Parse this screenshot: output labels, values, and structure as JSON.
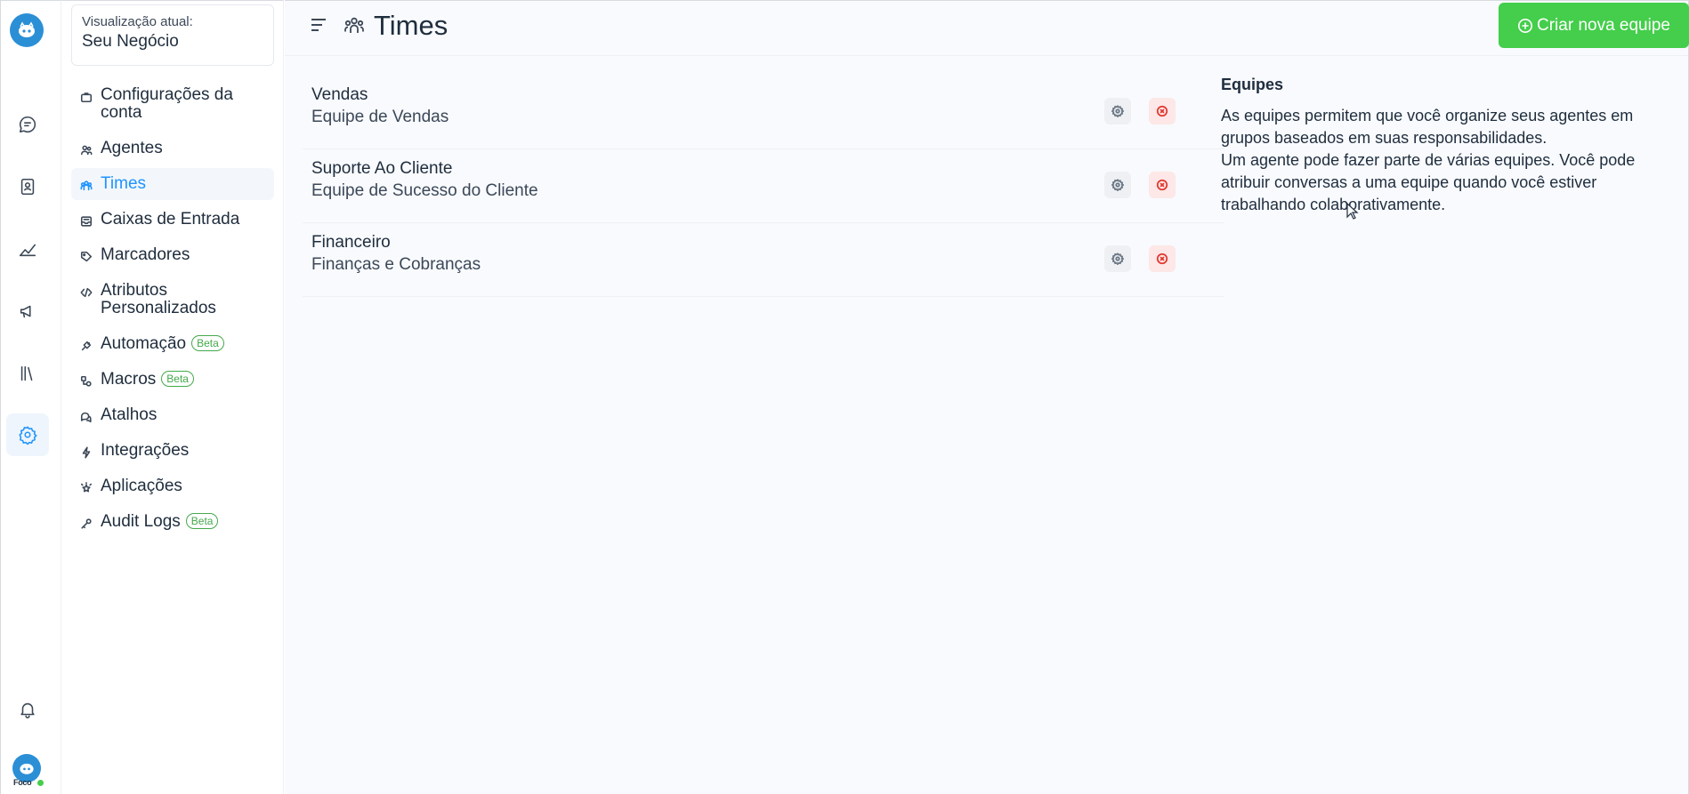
{
  "sidebar": {
    "account_label": "Visualização atual:",
    "account_value": "Seu Negócio",
    "items": [
      {
        "label": "Configurações da conta",
        "icon": "briefcase-icon"
      },
      {
        "label": "Agentes",
        "icon": "people-icon"
      },
      {
        "label": "Times",
        "icon": "people-team-icon"
      },
      {
        "label": "Caixas de Entrada",
        "icon": "mail-inbox-icon"
      },
      {
        "label": "Marcadores",
        "icon": "tag-icon"
      },
      {
        "label": "Atributos Personalizados",
        "icon": "code-icon"
      },
      {
        "label": "Automação",
        "icon": "automation-icon",
        "badge": "Beta"
      },
      {
        "label": "Macros",
        "icon": "flowchart-icon",
        "badge": "Beta"
      },
      {
        "label": "Atalhos",
        "icon": "chat-multiple-icon"
      },
      {
        "label": "Integrações",
        "icon": "flash-icon"
      },
      {
        "label": "Aplicações",
        "icon": "star-emphasis-icon"
      },
      {
        "label": "Audit Logs",
        "icon": "key-icon",
        "badge": "Beta"
      }
    ]
  },
  "rail": {
    "avatar_text": "Foco"
  },
  "header": {
    "title": "Times",
    "create_button": "Criar nova equipe"
  },
  "teams": [
    {
      "name": "Vendas",
      "description": "Equipe de Vendas"
    },
    {
      "name": "Suporte Ao Cliente",
      "description": "Equipe de Sucesso do Cliente"
    },
    {
      "name": "Financeiro",
      "description": "Finanças e Cobranças"
    }
  ],
  "help": {
    "title": "Equipes",
    "paragraph1": "As equipes permitem que você organize seus agentes em grupos baseados em suas responsabilidades.",
    "paragraph2": "Um agente pode fazer parte de várias equipes. Você pode atribuir conversas a uma equipe quando você estiver trabalhando colaborativamente."
  },
  "colors": {
    "accent": "#1f93ff",
    "success": "#44ce4b",
    "danger": "#e0382f"
  }
}
